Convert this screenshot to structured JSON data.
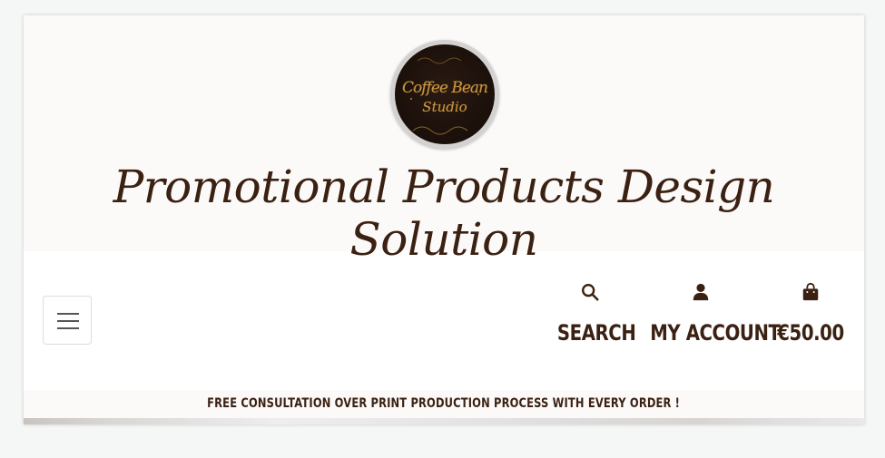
{
  "brand": {
    "logo_line_1": "Coffee Bean",
    "logo_line_2": "Studio",
    "tagline": "Promotional Products Design Solution"
  },
  "nav": {
    "menu_toggle_icon": "hamburger-icon",
    "search": {
      "icon": "search-icon",
      "label": "SEARCH"
    },
    "account": {
      "icon": "user-icon",
      "label": "MY ACCOUNT"
    },
    "bag": {
      "icon": "shopping-bag-icon",
      "label": "€50.00"
    }
  },
  "promo_banner": {
    "text": "FREE CONSULTATION OVER PRINT PRODUCTION PROCESS WITH EVERY ORDER !"
  },
  "colors": {
    "brand_brown": "#3b2112",
    "banner_bg": "#fcfaf9",
    "logo_gold": "#c8963e"
  }
}
